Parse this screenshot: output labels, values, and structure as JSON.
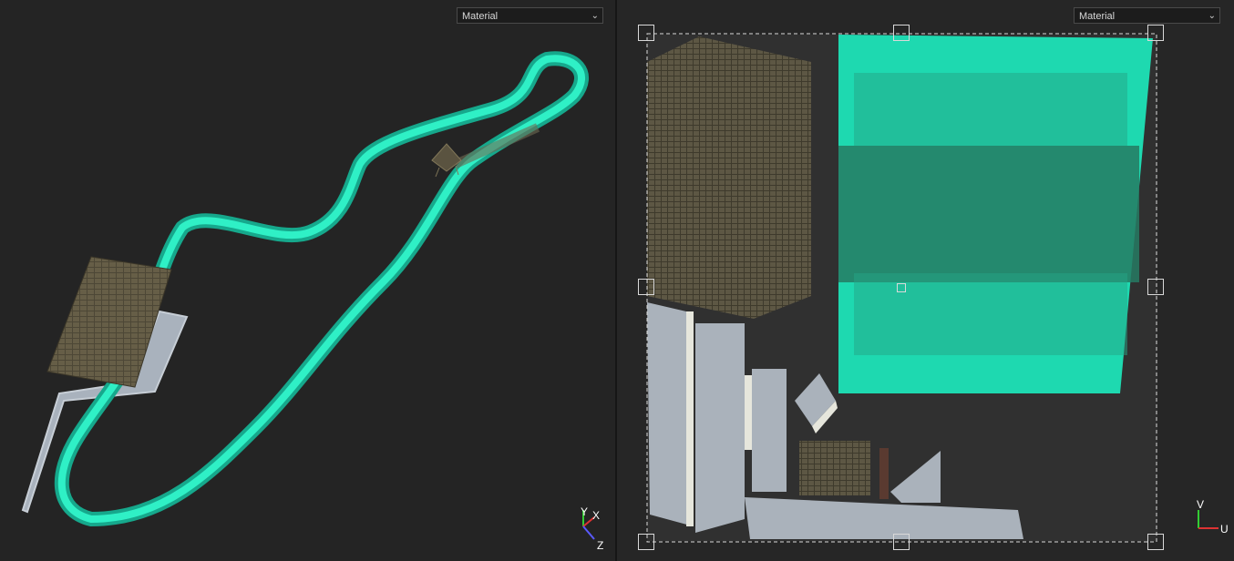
{
  "viewport3d": {
    "mode_select": "Material",
    "gizmo": {
      "y": "Y",
      "x": "X",
      "z": "Z"
    },
    "colors": {
      "track": "#1ed3b0",
      "roof": "#5a5340",
      "path": "#a9b2bd"
    }
  },
  "uv_editor": {
    "mode_select": "Material",
    "gizmo": {
      "v": "V",
      "u": "U"
    },
    "colors": {
      "water": "#1ed9b0",
      "selection": "#d9d9d9"
    }
  },
  "icons": {
    "dropdown": "chevron-down-icon",
    "gizmo3d": "axis-gizmo-icon",
    "gizmouv": "uv-axis-gizmo-icon"
  }
}
